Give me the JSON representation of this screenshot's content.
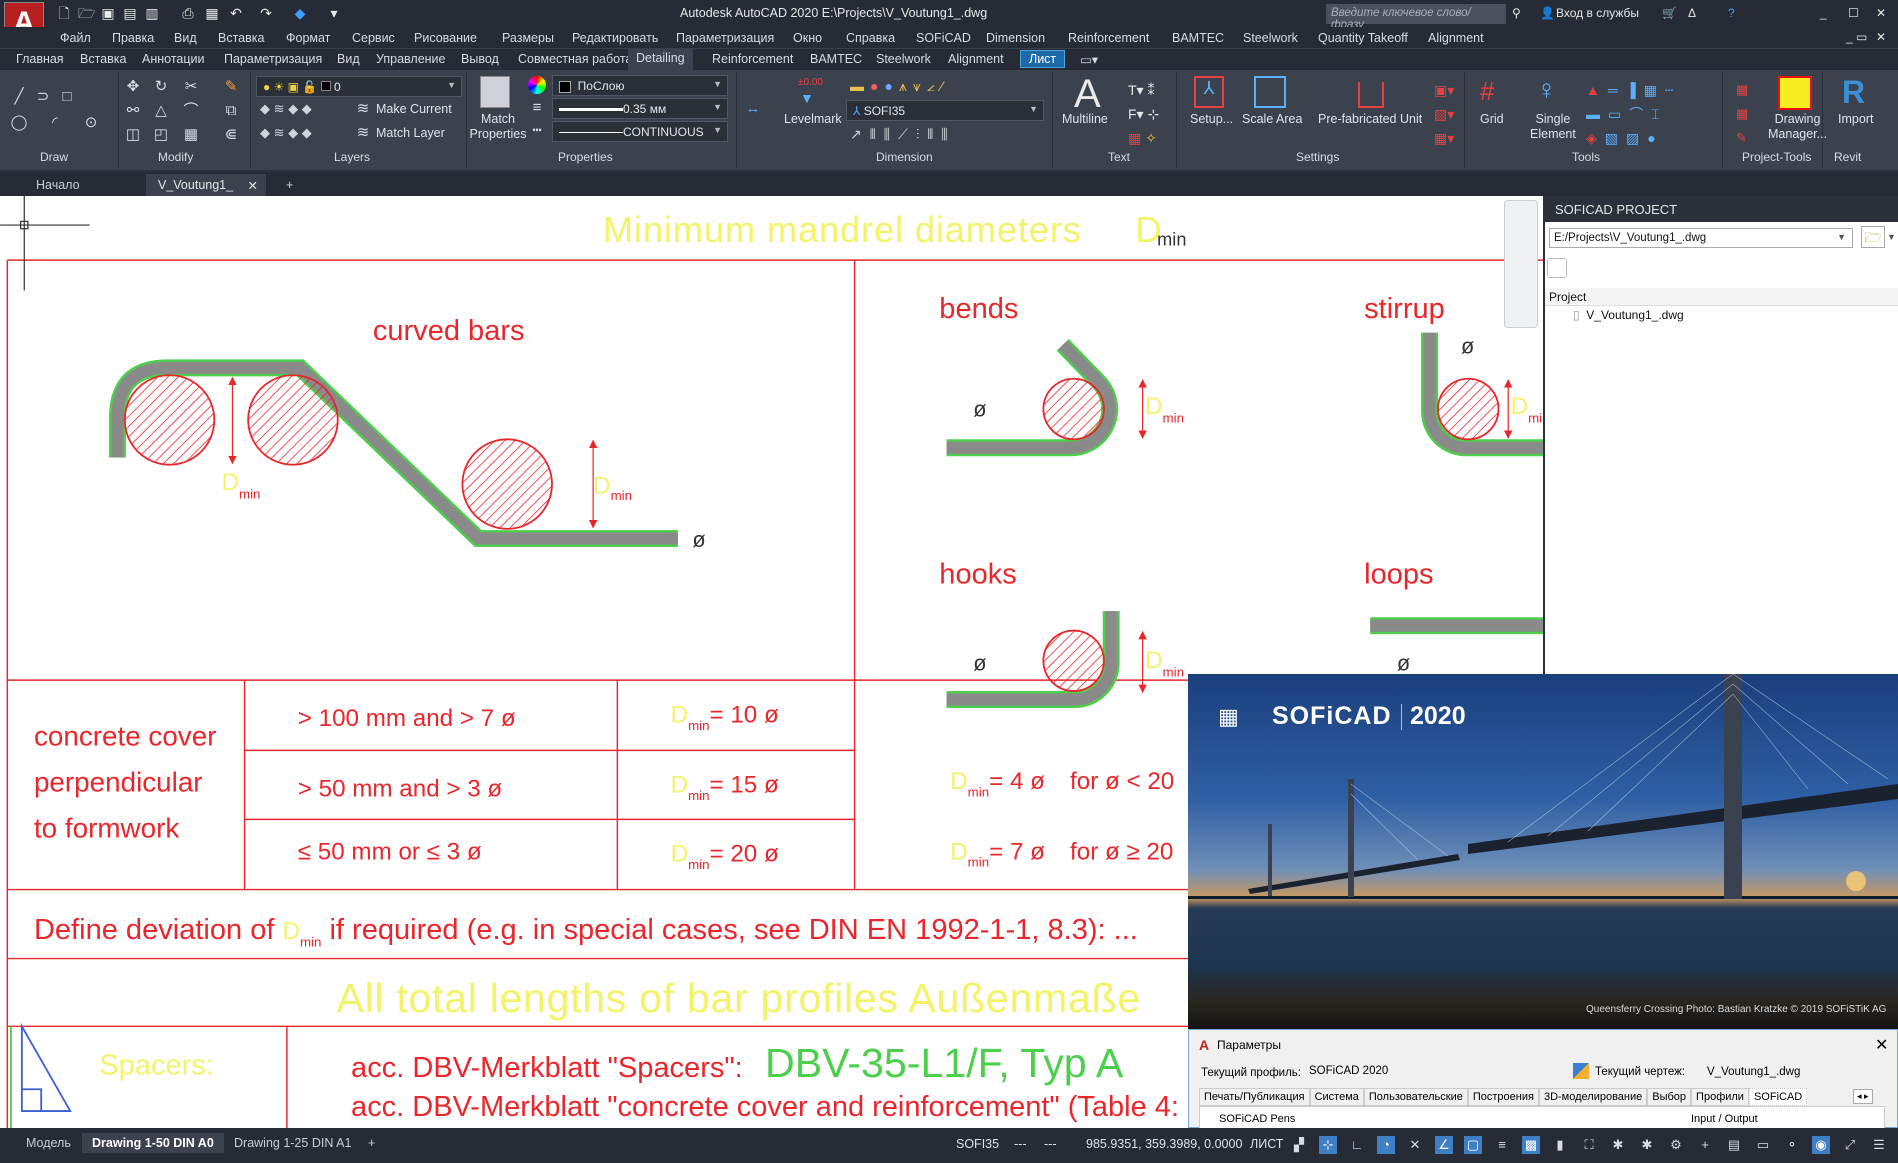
{
  "title": "Autodesk AutoCAD 2020   E:\\Projects\\V_Voutung1_.dwg",
  "search_placeholder": "Введите ключевое слово/фразу",
  "signin": "Вход в службы",
  "menu": [
    "Файл",
    "Правка",
    "Вид",
    "Вставка",
    "Формат",
    "Сервис",
    "Рисование",
    "Размеры",
    "Редактировать",
    "Параметризация",
    "Окно",
    "Справка",
    "SOFiCAD",
    "Dimension",
    "Reinforcement",
    "BAMTEC",
    "Steelwork",
    "Quantity Takeoff",
    "Alignment"
  ],
  "ribbon_tabs": [
    "Главная",
    "Вставка",
    "Аннотации",
    "Параметризация",
    "Вид",
    "Управление",
    "Вывод",
    "Совместная работа",
    "Detailing",
    "Reinforcement",
    "BAMTEC",
    "Steelwork",
    "Alignment",
    "Лист"
  ],
  "active_tab": "Detailing",
  "ribbon": {
    "panels": [
      "Draw",
      "Modify",
      "Layers",
      "Properties",
      "Dimension",
      "Text",
      "Settings",
      "Tools",
      "Project-Tools",
      "Revit"
    ],
    "layer_value": "0",
    "make_current": "Make Current",
    "match_layer": "Match Layer",
    "match_properties": [
      "Match",
      "Properties"
    ],
    "color_value": "ПоСлою",
    "lineweight_value": "0.35 мм",
    "linetype_value": "CONTINUOUS",
    "levelmark": "Levelmark",
    "levelmark_icon_text": "±0.00",
    "dimstyle_value": "SOFI35",
    "multiline": "Multiline",
    "setup": "Setup...",
    "scale_area": "Scale Area",
    "prefab": "Pre-fabricated Unit",
    "grid": "Grid",
    "single_element": [
      "Single",
      "Element"
    ],
    "drawing_manager": [
      "Drawing",
      "Manager..."
    ],
    "import": "Import"
  },
  "doc_tabs": [
    "Начало",
    "V_Voutung1_"
  ],
  "drawing": {
    "title": "Minimum  mandrel  diameters",
    "d": "D",
    "min": "min",
    "curved_bars": "curved bars",
    "bends": "bends",
    "stirrup": "stirrup",
    "hooks": "hooks",
    "loops": "loops",
    "dia": "ø",
    "cover_label": [
      "concrete cover",
      "perpendicular",
      "to formwork"
    ],
    "rows": [
      {
        "cond": ">  100  mm  and  >  7  ø",
        "val": "= 10  ø"
      },
      {
        "cond": ">   50  mm  and  >  3  ø",
        "val": "= 15  ø"
      },
      {
        "cond": "≤   50  mm  or   ≤  3  ø",
        "val": "= 20  ø"
      }
    ],
    "hook_rows": [
      {
        "val": "= 4  ø",
        "cond": "for  ø  <  20"
      },
      {
        "val": "= 7  ø",
        "cond": "for  ø  ≥  20"
      }
    ],
    "deviation_pre": "Define  deviation  of ",
    "deviation_post": " if  required  (e.g.  in  special  cases,  see  DIN  EN  1992-1-1,  8.3):  ...",
    "total_lengths": "All  total  lengths  of  bar  profiles  Außenmaße",
    "spacers": "Spacers:",
    "spacers_ref": "acc.  DBV-Merkblatt  \"Spacers\":",
    "spacers_type": "DBV-35-L1/F,  Typ  A",
    "cover_ref": "acc.  DBV-Merkblatt  \"concrete cover and reinforcement\"  (Table  4:",
    "colors": {
      "red": "#e8262b",
      "yellow": "#f3f36a",
      "green": "#4ccf4c",
      "bar": "#8a8a8a"
    }
  },
  "panel": {
    "title": "SOFICAD PROJECT",
    "path": "E:/Projects\\V_Voutung1_.dwg",
    "tree_header": "Project",
    "tree_item": "V_Voutung1_.dwg"
  },
  "splash": {
    "brand": "SOFiCAD",
    "year": "2020",
    "credit": "Queensferry Crossing  Photo: Bastian Kratzke  © 2019 SOFiSTiK AG"
  },
  "dialog": {
    "title": "Параметры",
    "profile_label": "Текущий профиль:",
    "profile_value": "SOFiCAD 2020",
    "drawing_label": "Текущий чертеж:",
    "drawing_value": "V_Voutung1_.dwg",
    "tabs": [
      "Печать/Публикация",
      "Система",
      "Пользовательские",
      "Построения",
      "3D-моделирование",
      "Выбор",
      "Профили",
      "SOFiCAD"
    ],
    "active_tab": "SOFiCAD",
    "group1": "SOFiCAD Pens",
    "group2": "Input / Output"
  },
  "status": {
    "layout_tabs": [
      "Модель",
      "Drawing 1-50 DIN A0",
      "Drawing 1-25 DIN A1"
    ],
    "active_layout": "Drawing 1-50 DIN A0",
    "dimstyle": "SOFI35",
    "dash1": "---",
    "dash2": "---",
    "coords": "985.9351, 359.3989, 0.0000",
    "space": "ЛИСТ"
  }
}
